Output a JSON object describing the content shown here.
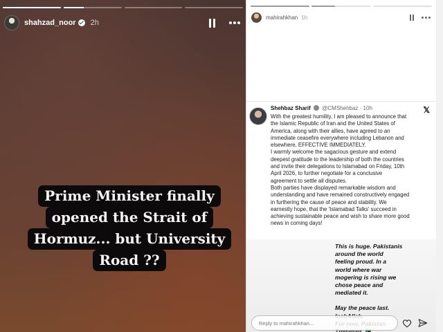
{
  "left_story": {
    "username": "shahzad_noor",
    "time": "2h",
    "progress_fill": [
      1,
      0.35,
      0,
      0
    ],
    "caption_lines": [
      "Prime Minister finally",
      "opened the Strait of",
      "Hormuz... but University",
      "Road ??"
    ]
  },
  "right_story": {
    "username": "mahirahkhan",
    "time": "1h",
    "progress_fill": [
      1,
      0.4,
      0
    ],
    "tweet": {
      "name": "Shehbaz Sharif",
      "handle": "@CMShehbaz",
      "time": "· 10h",
      "body_lines": [
        "With the greatest humility, I am pleased to announce that",
        "the Islamic Republic of Iran and the United States of",
        "America, along with their allies, have agreed to an",
        "immediate ceasefire everywhere including Lebanon and",
        "elsewhere, EFFECTIVE IMMEDIATELY.",
        "I warmly welcome the sagacious gesture and extend",
        "deepest gratitude to the leadership of both the countries",
        "and invite their delegations to Islamabad on Friday, 10th",
        "April 2026, to further negotiate for a conclusive",
        "agreement to settle all disputes.",
        "Both parties have displayed remarkable wisdom and",
        "understanding and have remained constructively engaged",
        "in furthering the cause of peace and stability. We",
        "earnestly hope, that the 'Islamabad Talks' succeed in",
        "achieving sustainable peace and wish to share more good",
        "news in coming days!"
      ]
    },
    "note": {
      "para1": "This is huge. Pakistanis\naround the world\nfeeling proud. In a\nworld where war\nmogering is rising we\nchose peace and\nmediated it.",
      "para2": "May the peace last.\nInshAllah.\nFor now, Pakistan\nZindabad 🇵🇰"
    },
    "reply_placeholder": "Reply to mahirahkhan..."
  },
  "icons": [
    "pause-icon",
    "more-icon",
    "x-logo-icon",
    "heart-icon",
    "send-icon",
    "verified-icon"
  ]
}
